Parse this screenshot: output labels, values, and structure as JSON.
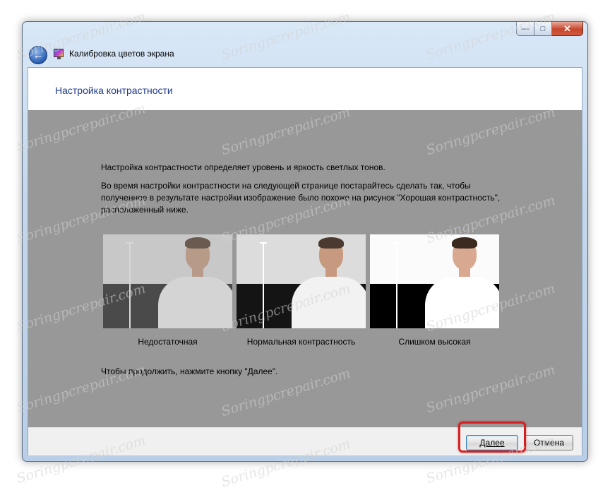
{
  "window": {
    "title": "Калибровка цветов экрана",
    "caption_buttons": {
      "minimize": "—",
      "maximize": "□",
      "close": "✕"
    }
  },
  "page": {
    "heading": "Настройка контрастности",
    "intro_1": "Настройка контрастности определяет уровень и яркость светлых тонов.",
    "intro_2": "Во время настройки контрастности на следующей странице постарайтесь сделать так, чтобы полученное в результате настройки изображение было похоже на рисунок \"Хорошая контрастность\", расположенный ниже.",
    "samples": [
      {
        "label": "Недостаточная",
        "wall": "#c8c8c8",
        "floor": "#4a4a4a",
        "pole": "#d8d8d8",
        "shirt": "#d4d4d4",
        "skin": "#b89a88",
        "hair": "#6a5a50"
      },
      {
        "label": "Нормальная контрастность",
        "wall": "#dcdcdc",
        "floor": "#141414",
        "pole": "#ffffff",
        "shirt": "#f2f2f2",
        "skin": "#c79a80",
        "hair": "#4a3a30"
      },
      {
        "label": "Слишком высокая",
        "wall": "#fbfbfb",
        "floor": "#000000",
        "pole": "#ffffff",
        "shirt": "#ffffff",
        "skin": "#d9a890",
        "hair": "#3a2a20"
      }
    ],
    "continue_note": "Чтобы продолжить, нажмите кнопку \"Далее\"."
  },
  "buttons": {
    "next": "Далее",
    "cancel": "Отмена"
  },
  "watermark": "Soringpcrepair.com",
  "colors": {
    "heading": "#1e3a8a",
    "gray_panel": "#989898",
    "highlight": "#d42020"
  }
}
